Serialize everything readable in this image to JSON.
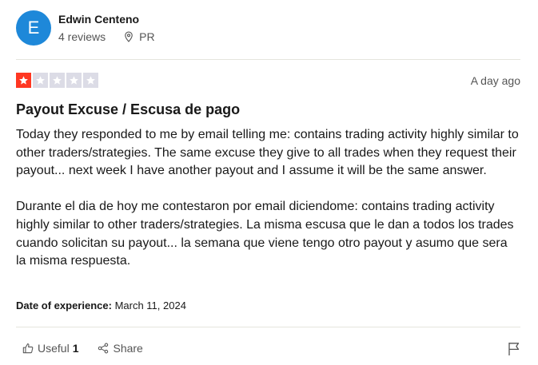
{
  "review": {
    "consumer": {
      "avatar_letter": "E",
      "name": "Edwin Centeno",
      "reviews_count": "4 reviews",
      "location": "PR",
      "avatar_color": "#1e88d9"
    },
    "rating": {
      "stars": 1,
      "max_stars": 5,
      "filled_color": "#ff3722",
      "empty_color": "#dcdce6"
    },
    "date_posted": "A day ago",
    "title": "Payout Excuse / Escusa de pago",
    "body": {
      "paragraph_en": "Today they responded to me by email telling me: contains trading activity highly similar to other traders/strategies. The same excuse they give to all trades when they request their payout... next week I have another payout and I assume it will be the same answer.",
      "paragraph_es": "Durante el dia de hoy me contestaron por email diciendome: contains trading activity highly similar to other traders/strategies. La misma escusa que le dan a todos los trades cuando solicitan su payout... la semana que viene tengo otro payout y asumo que sera la misma respuesta."
    },
    "experience": {
      "label": "Date of experience:",
      "date": "March 11, 2024"
    },
    "actions": {
      "useful_label": "Useful",
      "useful_count": "1",
      "share_label": "Share",
      "useful_icon": "thumbs-up-icon",
      "share_icon": "share-icon",
      "report_icon": "flag-icon"
    }
  }
}
